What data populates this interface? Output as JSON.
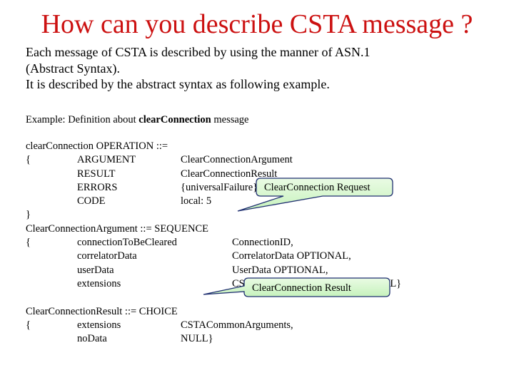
{
  "slide": {
    "title": "How can you describe CSTA message ?",
    "intro_lines": [
      "Each message of CSTA is described by using the manner of ASN.1",
      "(Abstract Syntax).",
      "It is described by the abstract syntax as following example."
    ],
    "example_heading": {
      "prefix": "Example: Definition about ",
      "bold": "clearConnection",
      "suffix": " message"
    },
    "operation_block": {
      "header": "clearConnection OPERATION ::=",
      "rows": [
        {
          "brace": "{",
          "key": "ARGUMENT",
          "value": "ClearConnectionArgument"
        },
        {
          "brace": "",
          "key": "RESULT",
          "value": "ClearConnectionResult"
        },
        {
          "brace": "",
          "key": "ERRORS",
          "value": "{universalFailure}"
        },
        {
          "brace": "",
          "key": "CODE",
          "value": "local: 5"
        }
      ],
      "close": "}"
    },
    "argument_block": {
      "header": "ClearConnectionArgument ::= SEQUENCE",
      "rows": [
        {
          "brace": "{",
          "key": "connectionToBeCleared",
          "value": "ConnectionID,"
        },
        {
          "brace": "",
          "key": "correlatorData",
          "value": "CorrelatorData OPTIONAL,"
        },
        {
          "brace": "",
          "key": "userData",
          "value": "UserData OPTIONAL,"
        },
        {
          "brace": "",
          "key": "extensions",
          "value": "CSTACommonArguments OPTIONAL}"
        }
      ]
    },
    "result_block": {
      "header": "ClearConnectionResult ::= CHOICE",
      "rows": [
        {
          "brace": "{",
          "key": "extensions",
          "value": "CSTACommonArguments,"
        },
        {
          "brace": "",
          "key": "noData",
          "value": "NULL}"
        }
      ]
    },
    "callouts": [
      {
        "label": "ClearConnection Request"
      },
      {
        "label": "ClearConnection Result"
      }
    ],
    "colors": {
      "title": "#cc1111",
      "callout_fill_top": "#eafbe4",
      "callout_fill_bottom": "#c6f2bc",
      "callout_border": "#1f2f70"
    }
  }
}
